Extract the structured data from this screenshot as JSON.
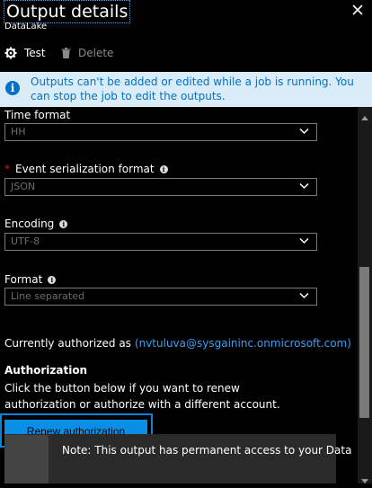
{
  "header": {
    "title": "Output details",
    "subtitle": "DataLake"
  },
  "toolbar": {
    "test_label": "Test",
    "delete_label": "Delete"
  },
  "info_bar": {
    "text": "Outputs can't be added or edited while a job is running. You can stop the job to edit the outputs."
  },
  "fields": {
    "time_format": {
      "label": "Time format",
      "value": "HH"
    },
    "event_serialization": {
      "label": "Event serialization format",
      "value": "JSON"
    },
    "encoding": {
      "label": "Encoding",
      "value": "UTF-8"
    },
    "format": {
      "label": "Format",
      "value": "Line separated"
    }
  },
  "authorization": {
    "current_label": "Currently authorized as",
    "current_account": "(nvtuluva@sysgaininc.onmicrosoft.com)",
    "heading": "Authorization",
    "description": "Click the button below if you want to renew authorization or authorize with a different account.",
    "renew_label": "Renew authorization"
  },
  "note": {
    "text": "Note: This output has permanent access to your Data"
  },
  "colors": {
    "accent": "#0a8ee6",
    "info_background": "#d9ecf7",
    "info_text": "#0072c6",
    "required": "#e81123",
    "link": "#3aa0f3"
  },
  "icons": {
    "close": "close-icon",
    "test": "gear-icon",
    "delete": "trash-icon",
    "info": "info-icon",
    "dropdown": "chevron-down-icon"
  }
}
